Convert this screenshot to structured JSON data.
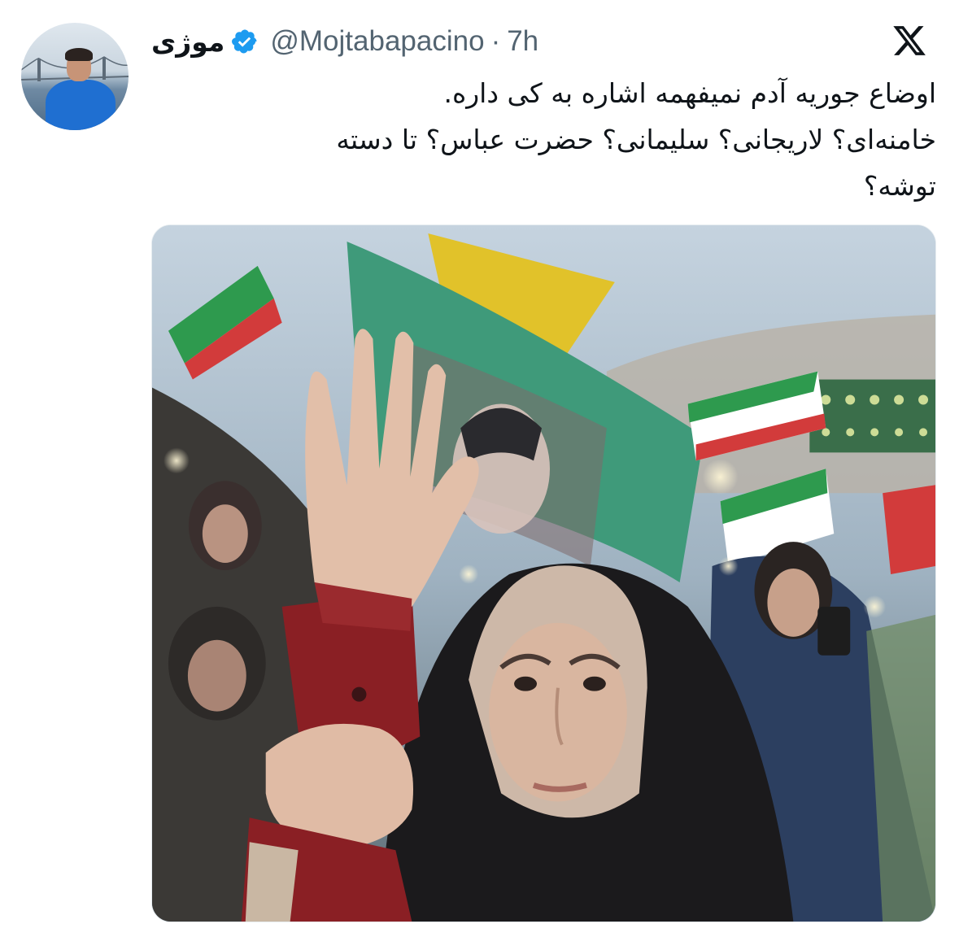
{
  "tweet": {
    "author": {
      "display_name": "موژی",
      "handle": "@Mojtabapacino",
      "verified": true,
      "avatar_icon": "profile-photo"
    },
    "separator": "·",
    "time": "7h",
    "platform_icon": "x-logo-icon",
    "text_lines": [
      "اوضاع جوریه آدم نمیفهمه اشاره به کی داره.",
      "خامنه‌ای؟ لاریجانی؟ سلیمانی؟ حضرت عباس؟ تا دسته",
      "توشه؟"
    ],
    "media": {
      "type": "photo",
      "description_icon": "protest-photo"
    }
  },
  "colors": {
    "text": "#0f1419",
    "secondary_text": "#536471",
    "verified_blue": "#1d9bf0",
    "background": "#ffffff"
  }
}
